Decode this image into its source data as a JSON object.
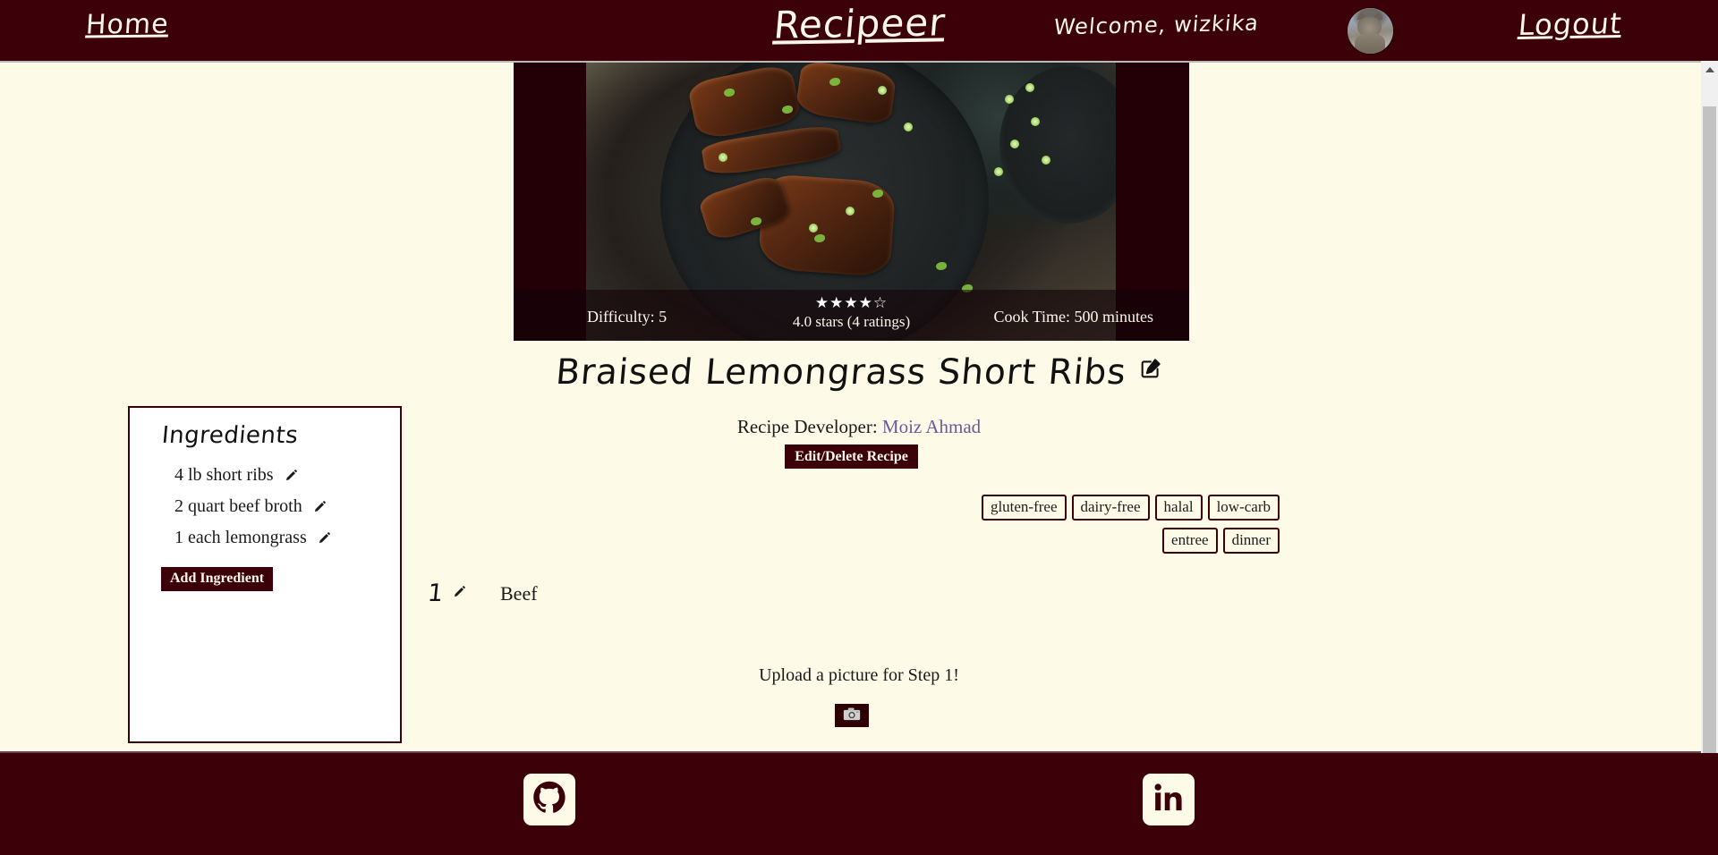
{
  "navbar": {
    "home_label": "Home",
    "brand": "Recipeer",
    "welcome": "Welcome, wizkika",
    "logout_label": "Logout",
    "avatar_alt": "user-avatar-cat",
    "bg_color": "#3B0008",
    "text_color": "#FDF6EC"
  },
  "hero": {
    "difficulty_label": "Difficulty: 5",
    "cook_time_label": "Cook Time: 500 minutes",
    "stars_display": "★★★★☆",
    "stars_filled": 4,
    "stars_total": 5,
    "rating_text": "4.0 stars (4 ratings)",
    "backdrop_color": "#220005",
    "overlay_color": "rgba(20,4,8,0.60)"
  },
  "recipe": {
    "title": "Braised Lemongrass Short Ribs",
    "title_edit_icon": "edit-square-icon",
    "developer_prefix": "Recipe Developer:",
    "developer_name": "Moiz Ahmad",
    "developer_link_color": "#6B5B9A",
    "edit_delete_label": "Edit/Delete Recipe"
  },
  "tags": {
    "row1": [
      "gluten-free",
      "dairy-free",
      "halal",
      "low-carb"
    ],
    "row2": [
      "entree",
      "dinner"
    ],
    "border_color": "#3B0008"
  },
  "ingredients": {
    "heading": "Ingredients",
    "items": [
      "4 lb short ribs",
      "2 quart beef broth",
      "1 each lemongrass"
    ],
    "add_button_label": "Add Ingredient",
    "panel_bg": "#FFFFFF",
    "panel_border": "#3B0008"
  },
  "steps": [
    {
      "number": "1",
      "text": "Beef",
      "edit_icon": "pencil-icon",
      "upload_prompt": "Upload a picture for Step 1!",
      "upload_icon": "camera-icon"
    }
  ],
  "footer": {
    "bg_color": "#3B0008",
    "social": [
      {
        "name": "github",
        "icon": "github-icon"
      },
      {
        "name": "linkedin",
        "icon": "linkedin-icon"
      }
    ]
  },
  "page": {
    "background_color": "#FDFAE8"
  },
  "scrollbar": {
    "up_arrow": "chevron-up-icon",
    "down_arrow": "chevron-down-icon",
    "thumb_color": "#C2C2C2",
    "track_color": "#F0F0F0"
  }
}
